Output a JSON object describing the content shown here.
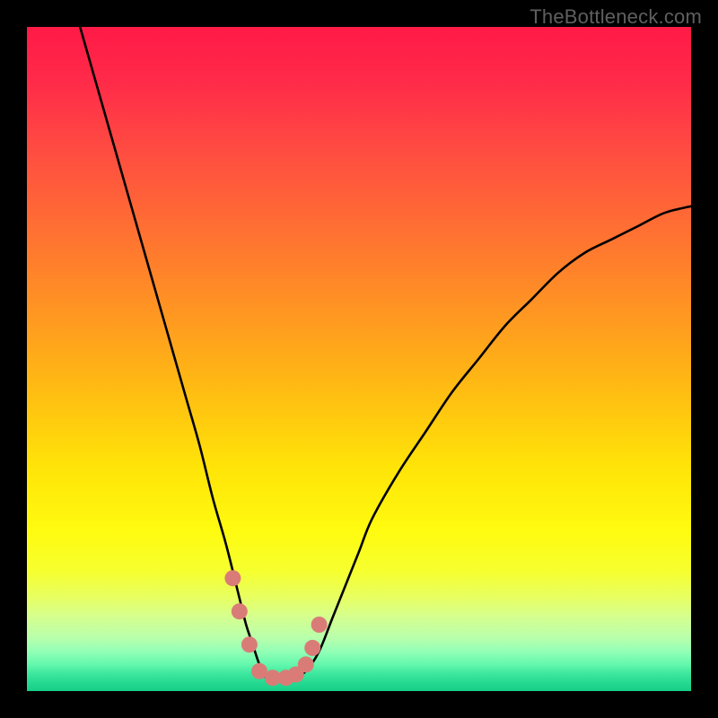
{
  "watermark": "TheBottleneck.com",
  "gradient_stops": [
    {
      "offset": 0.0,
      "color": "#ff1a46"
    },
    {
      "offset": 0.08,
      "color": "#ff2a49"
    },
    {
      "offset": 0.18,
      "color": "#ff4a42"
    },
    {
      "offset": 0.3,
      "color": "#ff6e33"
    },
    {
      "offset": 0.42,
      "color": "#ff9323"
    },
    {
      "offset": 0.55,
      "color": "#ffbd12"
    },
    {
      "offset": 0.66,
      "color": "#ffe308"
    },
    {
      "offset": 0.76,
      "color": "#fffb10"
    },
    {
      "offset": 0.82,
      "color": "#f6ff2f"
    },
    {
      "offset": 0.86,
      "color": "#e7ff63"
    },
    {
      "offset": 0.89,
      "color": "#d4ff91"
    },
    {
      "offset": 0.92,
      "color": "#b8ffab"
    },
    {
      "offset": 0.94,
      "color": "#93ffb6"
    },
    {
      "offset": 0.96,
      "color": "#63f8ad"
    },
    {
      "offset": 0.975,
      "color": "#3ae69c"
    },
    {
      "offset": 0.99,
      "color": "#22d78f"
    },
    {
      "offset": 1.0,
      "color": "#18cf88"
    }
  ],
  "chart_data": {
    "type": "line",
    "title": "",
    "xlabel": "",
    "ylabel": "",
    "xlim": [
      0,
      100
    ],
    "ylim": [
      0,
      100
    ],
    "series": [
      {
        "name": "curve",
        "x": [
          8,
          10,
          12,
          14,
          16,
          18,
          20,
          22,
          24,
          26,
          28,
          30,
          32,
          33,
          34,
          35,
          36,
          38,
          40,
          42,
          44,
          46,
          48,
          50,
          52,
          56,
          60,
          64,
          68,
          72,
          76,
          80,
          84,
          88,
          92,
          96,
          100
        ],
        "y": [
          100,
          93,
          86,
          79,
          72,
          65,
          58,
          51,
          44,
          37,
          29,
          22,
          14,
          10,
          7,
          4,
          2,
          2,
          2,
          3,
          6,
          11,
          16,
          21,
          26,
          33,
          39,
          45,
          50,
          55,
          59,
          63,
          66,
          68,
          70,
          72,
          73
        ]
      }
    ],
    "highlight_points": {
      "name": "marked-range",
      "x": [
        31.0,
        32.0,
        33.5,
        35.0,
        37.0,
        39.0,
        40.5,
        42.0,
        43.0,
        44.0
      ],
      "y": [
        17,
        12,
        7,
        3,
        2,
        2,
        2.5,
        4,
        6.5,
        10
      ]
    }
  },
  "colors": {
    "curve": "#000000",
    "dots": "#d97c78",
    "background_border": "#000000"
  }
}
